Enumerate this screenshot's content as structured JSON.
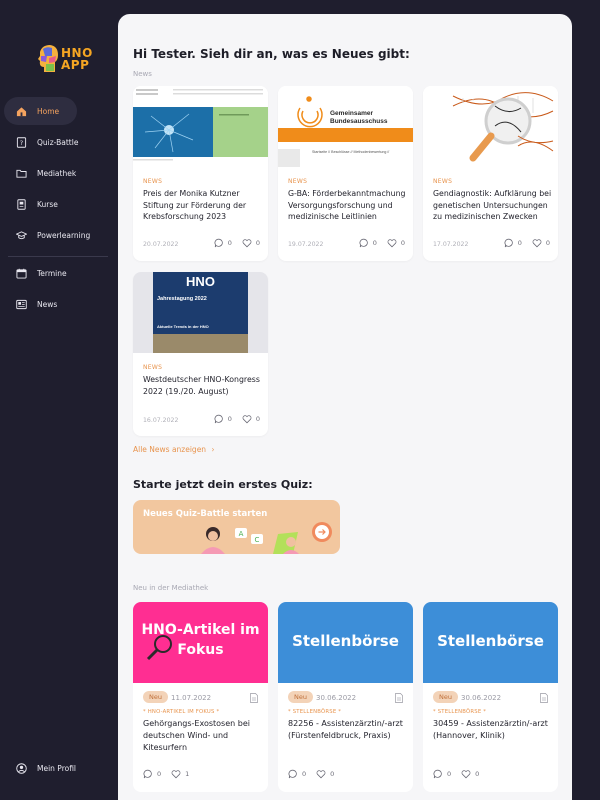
{
  "app": {
    "logo_line1": "HNO",
    "logo_line2": "APP"
  },
  "sidebar": {
    "items": [
      {
        "label": "Home",
        "icon": "home-icon",
        "active": true
      },
      {
        "label": "Quiz-Battle",
        "icon": "quiz-icon"
      },
      {
        "label": "Mediathek",
        "icon": "folder-icon"
      },
      {
        "label": "Kurse",
        "icon": "course-icon"
      },
      {
        "label": "Powerlearning",
        "icon": "graduation-cap-icon"
      },
      {
        "label": "Termine",
        "icon": "calendar-icon"
      },
      {
        "label": "News",
        "icon": "newspaper-icon"
      }
    ],
    "profile": {
      "label": "Mein Profil",
      "icon": "user-icon"
    }
  },
  "main": {
    "greeting": "Hi Tester. Sieh dir an, was es Neues gibt:",
    "news_label": "News",
    "news": [
      {
        "tag": "NEWS",
        "title": "Preis der Monika Kutzner Stiftung zur Förderung der Krebsforschung 2023",
        "date": "20.07.2022",
        "comments": "0",
        "likes": "0"
      },
      {
        "tag": "NEWS",
        "title": "G-BA: Förderbekanntmachung Versorgungsforschung und medizinische Leitlinien",
        "date": "19.07.2022",
        "comments": "0",
        "likes": "0",
        "image_text": "Gemeinsamer Bundesausschuss",
        "image_subtext": "Startseite // Beschlüsse // Methodenbewertung //"
      },
      {
        "tag": "NEWS",
        "title": "Gendiagnostik: Aufklärung bei genetischen Untersuchungen zu medizinischen Zwecken",
        "date": "17.07.2022",
        "comments": "0",
        "likes": "0"
      },
      {
        "tag": "NEWS",
        "title": "Westdeutscher HNO-Kongress 2022 (19./20. August)",
        "date": "16.07.2022",
        "comments": "0",
        "likes": "0",
        "image_text": "Jahrestagung 2022",
        "image_logo": "HNO",
        "image_subtext": "Aktuelle Trends in der HNO"
      }
    ],
    "all_news": "Alle News anzeigen",
    "quiz_heading": "Starte jetzt dein erstes Quiz:",
    "quiz_banner": "Neues Quiz-Battle starten",
    "mediathek_label": "Neu in der Mediathek",
    "mediathek": [
      {
        "badge": "Neu",
        "date": "11.07.2022",
        "tag": "* HNO-ARTIKEL IM FOKUS *",
        "title": "Gehörgangs-Exostosen bei deutschen Wind- und Kitesurfern",
        "comments": "0",
        "likes": "1",
        "image_text": "HNO-Artikel im Fokus",
        "color": "#ff2e92"
      },
      {
        "badge": "Neu",
        "date": "30.06.2022",
        "tag": "* STELLENBÖRSE *",
        "title": "82256 - Assistenzärztin/-arzt (Fürstenfeldbruck, Praxis)",
        "comments": "0",
        "likes": "0",
        "image_text": "Stellenbörse",
        "color": "#3d8ed8"
      },
      {
        "badge": "Neu",
        "date": "30.06.2022",
        "tag": "* STELLENBÖRSE *",
        "title": "30459 - Assistenzärztin/-arzt (Hannover, Klinik)",
        "comments": "0",
        "likes": "0",
        "image_text": "Stellenbörse",
        "color": "#3d8ed8"
      }
    ]
  },
  "colors": {
    "accent": "#e8944e",
    "sidebar_bg": "#1f1e2e",
    "main_bg": "#f6f6f8"
  }
}
